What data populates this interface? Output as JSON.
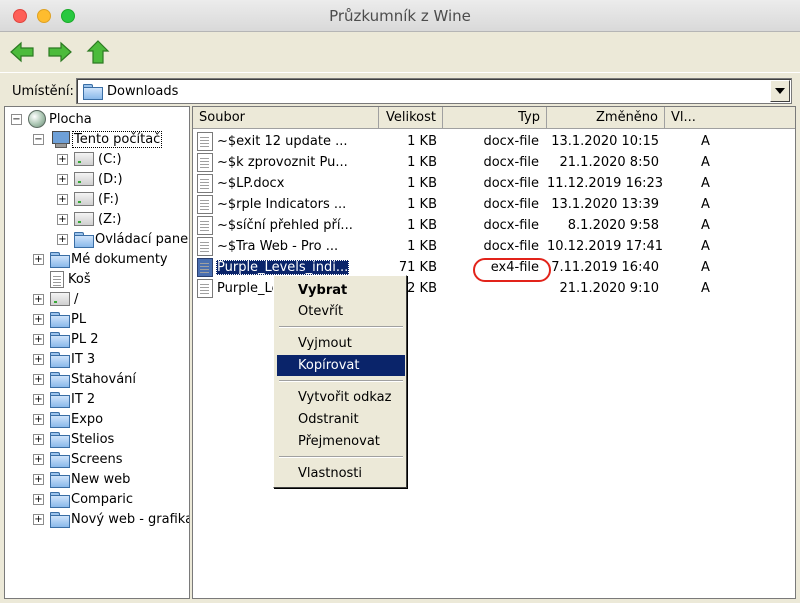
{
  "window": {
    "title": "Průzkumník z Wine"
  },
  "toolbar": {
    "back_icon": "arrow-left-icon",
    "forward_icon": "arrow-right-icon",
    "up_icon": "arrow-up-icon",
    "icon_color": "#3aa52e"
  },
  "location": {
    "label": "Umístění:",
    "value": "Downloads"
  },
  "tree": {
    "items": [
      {
        "label": "Plocha",
        "expander": "−",
        "icon": "desktop-globe-icon"
      },
      {
        "label": "Tento počítač",
        "expander": "−",
        "icon": "computer-icon"
      },
      {
        "label": "(C:)",
        "expander": "+",
        "icon": "drive-icon"
      },
      {
        "label": "(D:)",
        "expander": "+",
        "icon": "drive-icon"
      },
      {
        "label": "(F:)",
        "expander": "+",
        "icon": "drive-icon"
      },
      {
        "label": "(Z:)",
        "expander": "+",
        "icon": "drive-icon"
      },
      {
        "label": "Ovládací panel",
        "expander": "+",
        "icon": "folder-icon"
      },
      {
        "label": "Mé dokumenty",
        "expander": "+",
        "icon": "folder-icon"
      },
      {
        "label": "Koš",
        "expander": "",
        "icon": "document-icon"
      },
      {
        "label": "/",
        "expander": "+",
        "icon": "drive-icon"
      },
      {
        "label": "PL",
        "expander": "+",
        "icon": "folder-icon"
      },
      {
        "label": "PL 2",
        "expander": "+",
        "icon": "folder-icon"
      },
      {
        "label": "IT 3",
        "expander": "+",
        "icon": "folder-icon"
      },
      {
        "label": "Stahování",
        "expander": "+",
        "icon": "folder-icon"
      },
      {
        "label": "IT 2",
        "expander": "+",
        "icon": "folder-icon"
      },
      {
        "label": "Expo",
        "expander": "+",
        "icon": "folder-icon"
      },
      {
        "label": "Stelios",
        "expander": "+",
        "icon": "folder-icon"
      },
      {
        "label": "Screens",
        "expander": "+",
        "icon": "folder-icon"
      },
      {
        "label": "New web",
        "expander": "+",
        "icon": "folder-icon"
      },
      {
        "label": "Comparic",
        "expander": "+",
        "icon": "folder-icon"
      },
      {
        "label": "Nový web - grafika",
        "expander": "+",
        "icon": "folder-icon"
      }
    ]
  },
  "list": {
    "columns": [
      "Soubor",
      "Velikost",
      "Typ",
      "Změněno",
      "Vl..."
    ],
    "rows": [
      {
        "name": "~$exit 12 update ...",
        "size": "1 KB",
        "type": "docx-file",
        "modified": "13.1.2020 10:15",
        "attr": "A"
      },
      {
        "name": "~$k zprovoznit Pu...",
        "size": "1 KB",
        "type": "docx-file",
        "modified": "21.1.2020 8:50",
        "attr": "A"
      },
      {
        "name": "~$LP.docx",
        "size": "1 KB",
        "type": "docx-file",
        "modified": "11.12.2019 16:23",
        "attr": "A"
      },
      {
        "name": "~$rple Indicators ...",
        "size": "1 KB",
        "type": "docx-file",
        "modified": "13.1.2020 13:39",
        "attr": "A"
      },
      {
        "name": "~$síční přehled pří...",
        "size": "1 KB",
        "type": "docx-file",
        "modified": "8.1.2020 9:58",
        "attr": "A"
      },
      {
        "name": "~$Tra Web - Pro ...",
        "size": "1 KB",
        "type": "docx-file",
        "modified": "10.12.2019 17:41",
        "attr": "A"
      },
      {
        "name": "Purple_Levels_indi...",
        "size": "71 KB",
        "type": "ex4-file",
        "modified": "7.11.2019 16:40",
        "attr": "A"
      },
      {
        "name": "Purple_Le",
        "size": "72 KB",
        "type": "",
        "modified": "21.1.2020 9:10",
        "attr": "A"
      }
    ]
  },
  "context_menu": {
    "items": [
      {
        "label": "Vybrat",
        "style": "bold"
      },
      {
        "label": "Otevřít"
      },
      {
        "label": "Vyjmout"
      },
      {
        "label": "Kopírovat",
        "style": "active"
      },
      {
        "label": "Vytvořit odkaz"
      },
      {
        "label": "Odstranit"
      },
      {
        "label": "Přejmenovat"
      },
      {
        "label": "Vlastnosti"
      }
    ]
  },
  "colors": {
    "selection": "#0a246a",
    "highlight_circle": "#e2231a"
  }
}
